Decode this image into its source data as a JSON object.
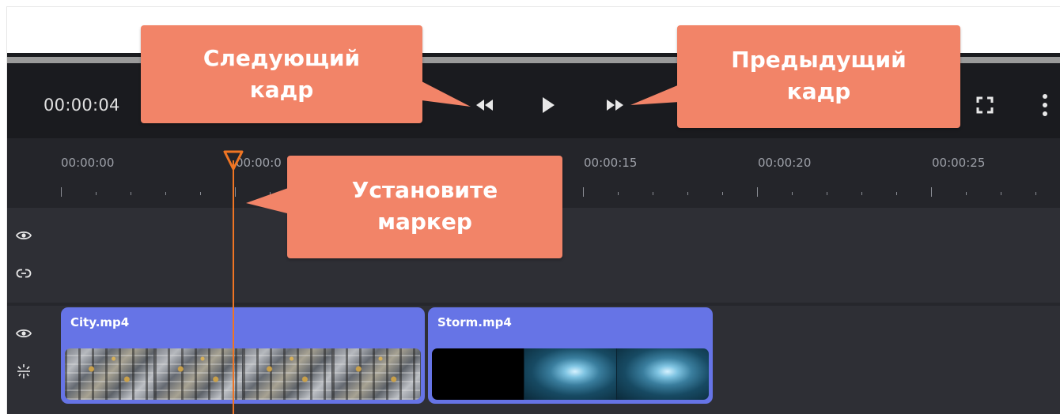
{
  "player": {
    "timecode": "00:00:04",
    "buttons": {
      "prev_frame": "rewind-frame-icon",
      "play": "play-icon",
      "next_frame": "forward-frame-icon",
      "fullscreen": "fullscreen-icon",
      "more": "more-vertical-icon"
    }
  },
  "ruler": {
    "ticks": [
      "00:00:00",
      "00:00:0",
      "00:00:15",
      "00:00:20",
      "00:00:25"
    ]
  },
  "tracks": [
    {
      "icons": [
        "eye-icon",
        "link-icon"
      ]
    },
    {
      "icons": [
        "eye-icon",
        "sparkle-effects-icon"
      ]
    }
  ],
  "clips": [
    {
      "name": "City.mp4",
      "thumbnail": "city-aerial"
    },
    {
      "name": "Storm.mp4",
      "thumbnail": "storm-lightning"
    }
  ],
  "callouts": {
    "next_frame": {
      "line1": "Следующий",
      "line2": "кадр"
    },
    "prev_frame": {
      "line1": "Предыдущий",
      "line2": "кадр"
    },
    "set_marker": {
      "line1": "Установите",
      "line2": "маркер"
    }
  },
  "colors": {
    "callout": "#f28468",
    "clip": "#6674e6",
    "playhead": "#f07523",
    "panel": "#1a1b1f",
    "track": "#2e2f35"
  }
}
